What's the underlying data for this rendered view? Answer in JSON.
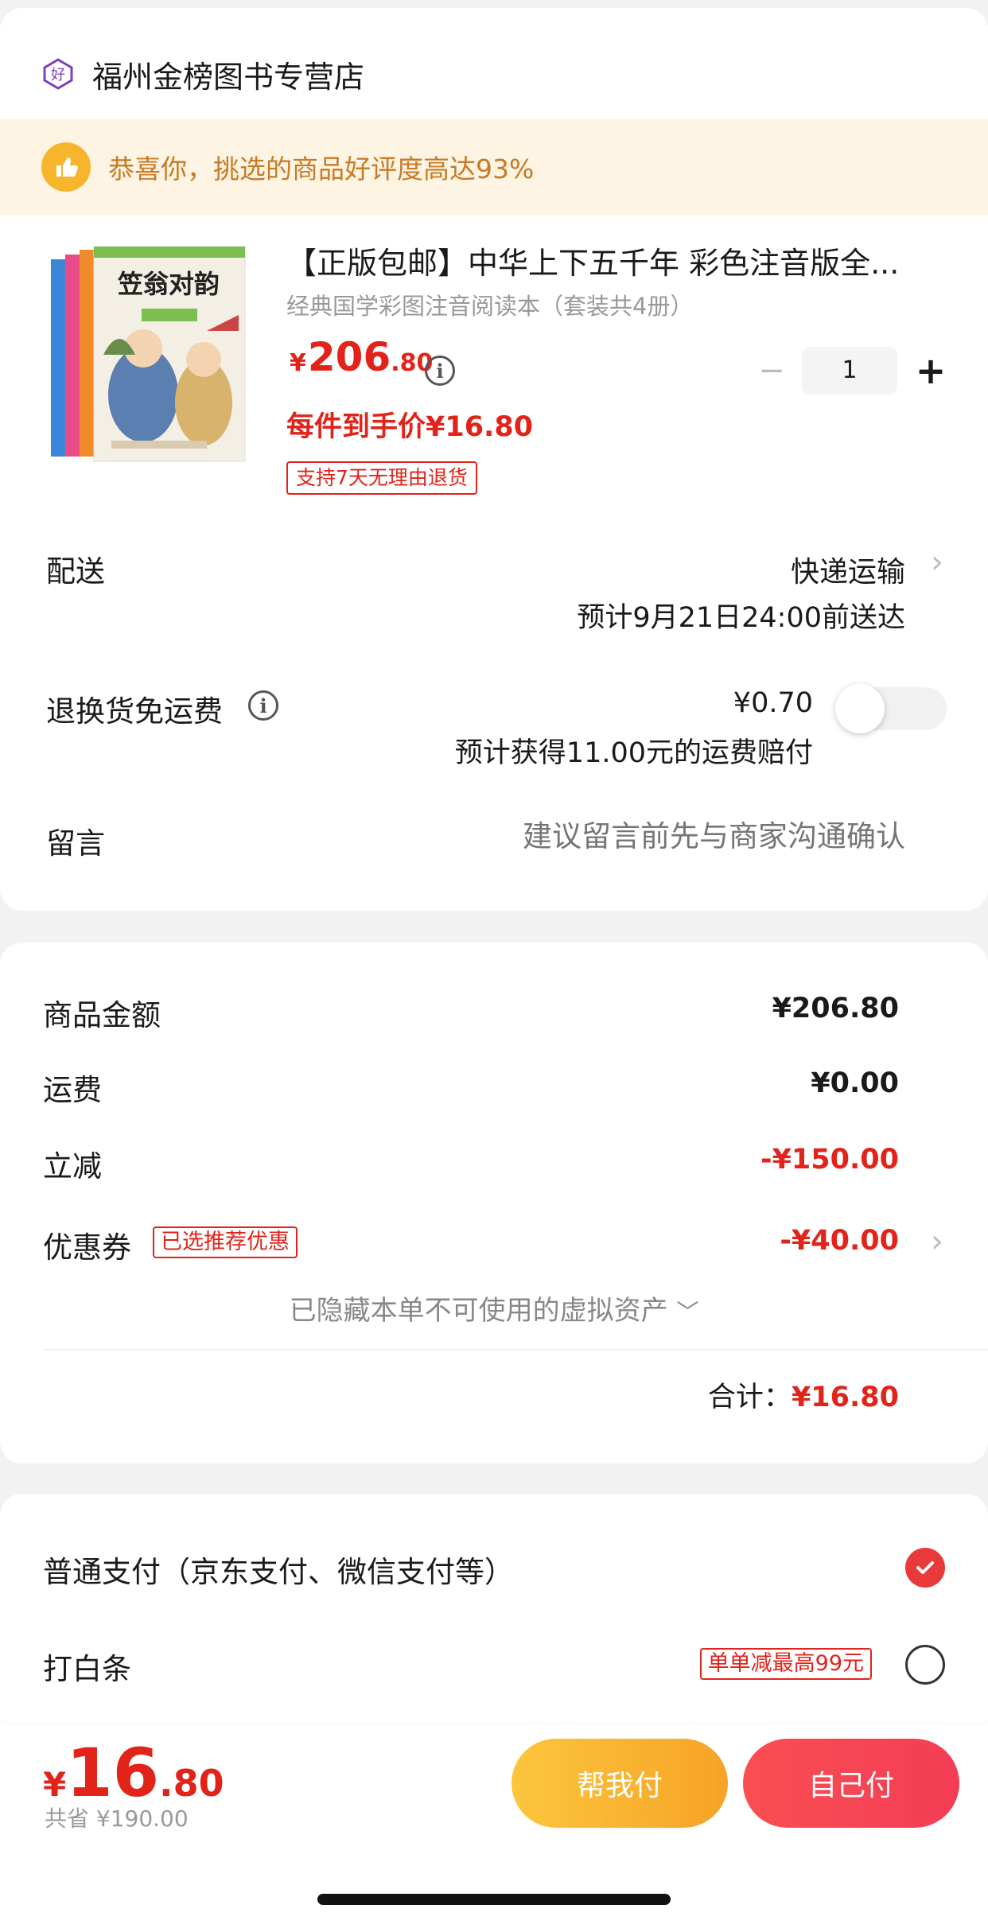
{
  "store": {
    "name": "福州金榜图书专营店",
    "icon": "hao-badge-icon"
  },
  "banner": {
    "text": "恭喜你，挑选的商品好评度高达93%",
    "icon": "thumbs-up-icon"
  },
  "product": {
    "cover_title": "笠翁对韵",
    "title": "【正版包邮】中华上下五千年 彩色注音版全...",
    "subtitle": "经典国学彩图注音阅读本（套装共4册）",
    "price_symbol": "¥",
    "price_int": "206",
    "price_dec": ".80",
    "quantity": "1",
    "qty_minus": "−",
    "qty_plus": "+",
    "each_price": "每件到手价¥16.80",
    "return_tag": "支持7天无理由退货"
  },
  "delivery": {
    "label": "配送",
    "method": "快递运输",
    "eta": "预计9月21日24:00前送达"
  },
  "return_insurance": {
    "label": "退换货免运费",
    "price": "¥0.70",
    "note": "预计获得11.00元的运费赔付",
    "enabled": false
  },
  "message": {
    "label": "留言",
    "placeholder": "建议留言前先与商家沟通确认"
  },
  "summary": {
    "goods_label": "商品金额",
    "goods_value": "¥206.80",
    "shipping_label": "运费",
    "shipping_value": "¥0.00",
    "discount_label": "立减",
    "discount_value": "-¥150.00",
    "coupon_label": "优惠券",
    "coupon_tag": "已选推荐优惠",
    "coupon_value": "-¥40.00",
    "hidden_note": "已隐藏本单不可使用的虚拟资产",
    "total_label": "合计：",
    "total_value": "¥16.80"
  },
  "payment": {
    "normal_label": "普通支付（京东支付、微信支付等）",
    "baitiao_label": "打白条",
    "baitiao_tag": "单单减最高99元",
    "selected": "normal"
  },
  "bottom": {
    "price_symbol": "¥",
    "price_int": "16",
    "price_dec": ".80",
    "saved": "共省 ¥190.00",
    "help_pay": "帮我付",
    "self_pay": "自己付"
  },
  "colors": {
    "accent": "#e2231a",
    "banner_bg": "#fdf4e3",
    "banner_text": "#c87a24"
  }
}
